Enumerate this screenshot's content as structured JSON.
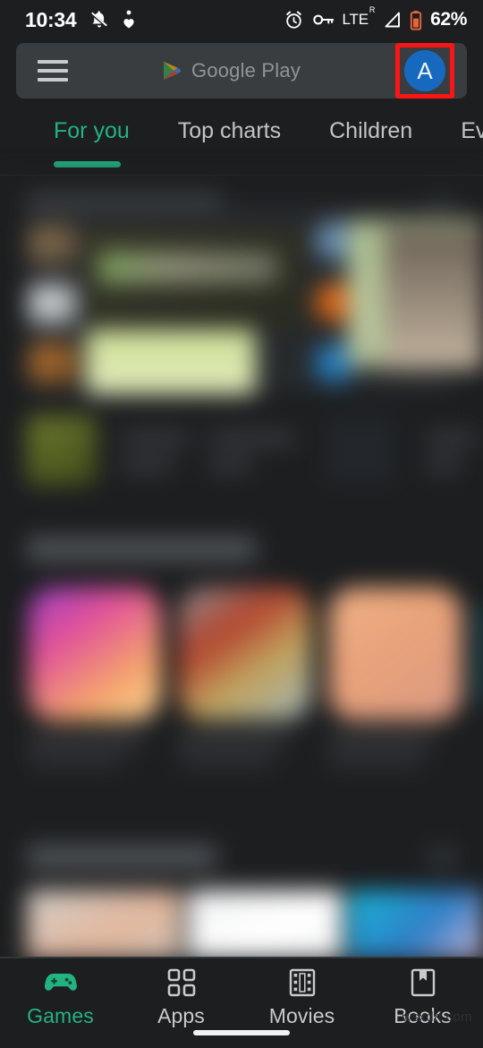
{
  "status_bar": {
    "time": "10:34",
    "left_icons": [
      "notifications-off-icon",
      "heart-person-icon"
    ],
    "network_label": "LTE",
    "roaming_superscript": "R",
    "battery_percent": "62%",
    "right_icons": [
      "alarm-icon",
      "vpn-key-icon",
      "signal-icon",
      "battery-icon"
    ],
    "battery_color": "#e8633a",
    "text_color": "#ffffff"
  },
  "search_bar": {
    "menu_icon": "hamburger-menu-icon",
    "brand_icon": "google-play-icon",
    "placeholder": "Google Play",
    "avatar_initial": "A",
    "avatar_color": "#1769c0",
    "highlight_color": "#fb1616",
    "highlight_label": "account-avatar-highlight"
  },
  "tabs": {
    "items": [
      {
        "label": "For you",
        "active": true
      },
      {
        "label": "Top charts",
        "active": false
      },
      {
        "label": "Children",
        "active": false
      },
      {
        "label": "Even",
        "active": false
      }
    ],
    "active_color": "#23b383",
    "inactive_color": "#c2c5c7"
  },
  "content": {
    "blurred": true,
    "sections": [
      {
        "name": "promo-section",
        "has_more_button": true
      },
      {
        "name": "suggested-section",
        "has_more_button": false
      },
      {
        "name": "featured-section",
        "has_more_button": true
      }
    ]
  },
  "bottom_nav": {
    "items": [
      {
        "label": "Games",
        "icon": "gamepad-icon",
        "active": true
      },
      {
        "label": "Apps",
        "icon": "grid-apps-icon",
        "active": false
      },
      {
        "label": "Movies",
        "icon": "film-strip-icon",
        "active": false
      },
      {
        "label": "Books",
        "icon": "book-bookmark-icon",
        "active": false
      }
    ],
    "active_color": "#23b383",
    "inactive_color": "#c8cbcd"
  },
  "watermark": {
    "text": "wsxdn.com"
  },
  "system": {
    "home_indicator": "home-gesture-bar"
  }
}
